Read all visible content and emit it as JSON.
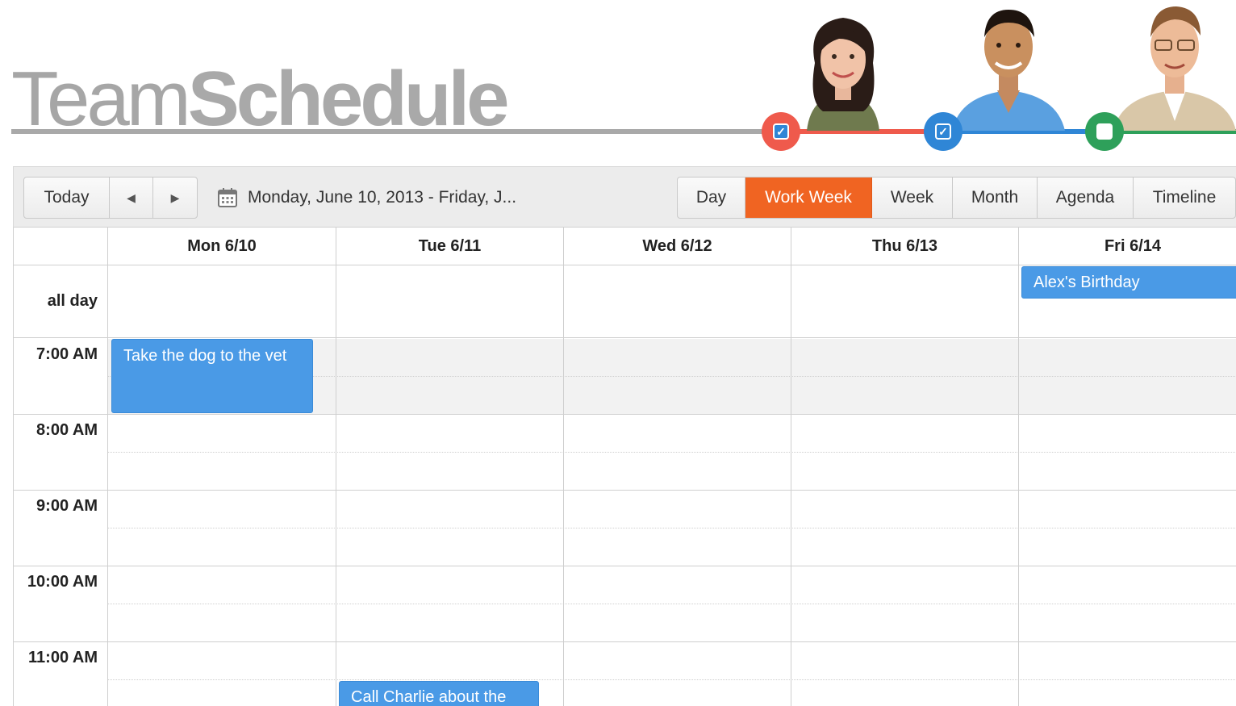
{
  "app": {
    "logo_light": "Team",
    "logo_bold": "Schedule"
  },
  "people": [
    {
      "name": "woman-avatar",
      "color": "#ef5a4c",
      "checked": true
    },
    {
      "name": "man-avatar",
      "color": "#2f86d6",
      "checked": true
    },
    {
      "name": "man-glasses-avatar",
      "color": "#2ea05a",
      "checked": false
    }
  ],
  "toolbar": {
    "today_label": "Today",
    "prev_icon": "◀",
    "next_icon": "▶",
    "date_range": "Monday, June 10, 2013 - Friday, J...",
    "views": [
      "Day",
      "Work Week",
      "Week",
      "Month",
      "Agenda",
      "Timeline"
    ],
    "active_view": "Work Week",
    "accent": "#f06422"
  },
  "calendar": {
    "days": [
      "Mon 6/10",
      "Tue 6/11",
      "Wed 6/12",
      "Thu 6/13",
      "Fri 6/14"
    ],
    "all_day_label": "all day",
    "times": [
      "7:00 AM",
      "8:00 AM",
      "9:00 AM",
      "10:00 AM",
      "11:00 AM"
    ],
    "events": [
      {
        "title": "Alex's Birthday",
        "day": "Fri 6/14",
        "all_day": true,
        "color": "#4a9ae6"
      },
      {
        "title": "Take the dog to the vet",
        "day": "Mon 6/10",
        "start": "7:00 AM",
        "color": "#4a9ae6"
      },
      {
        "title": "Call Charlie about the",
        "day": "Tue 6/11",
        "start": "11:30 AM",
        "color": "#4a9ae6"
      }
    ]
  }
}
